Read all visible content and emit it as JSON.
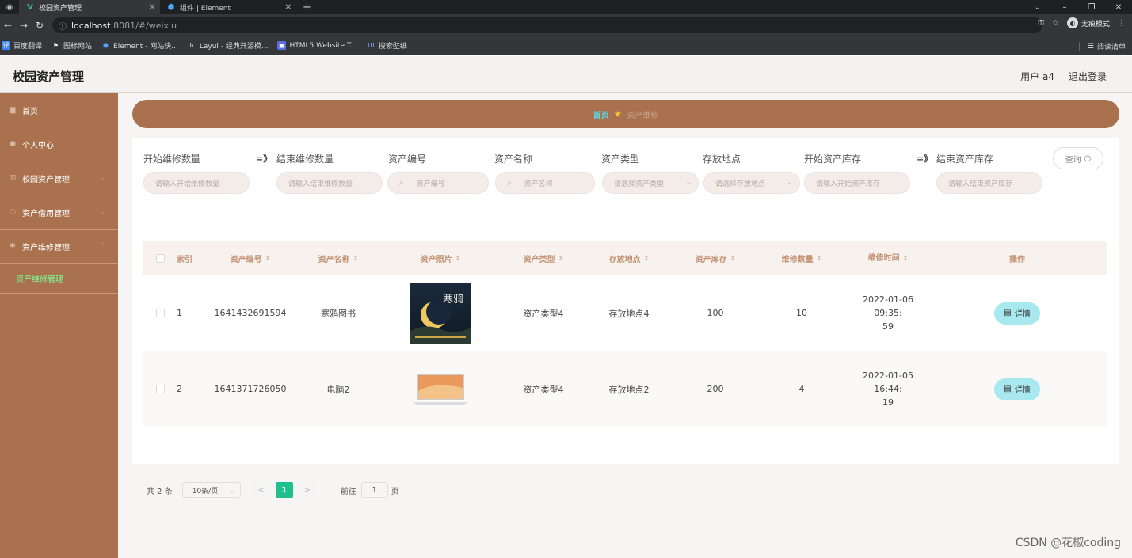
{
  "browser": {
    "tabs": [
      {
        "title": "校园资产管理",
        "icon": "vue-favicon-icon"
      },
      {
        "title": "组件 | Element",
        "icon": "element-favicon-icon"
      }
    ],
    "url_host": "localhost",
    "url_path": ":8081/#/weixiu",
    "incognito_label": "无痕模式",
    "bookmarks": [
      "百度翻译",
      "图标网站",
      "Element - 网站快...",
      "Layui - 经典开源模...",
      "HTML5 Website T...",
      "搜索壁纸"
    ],
    "reading_list": "阅读清单"
  },
  "header": {
    "title": "校园资产管理",
    "user": "用户 a4",
    "logout": "退出登录"
  },
  "sidebar": {
    "items": [
      {
        "label": "首页"
      },
      {
        "label": "个人中心"
      },
      {
        "label": "校园资产管理"
      },
      {
        "label": "资产借用管理"
      },
      {
        "label": "资产维修管理"
      }
    ],
    "active_sub": "资产维修管理"
  },
  "breadcrumb": {
    "home": "首页",
    "current": "资产维修"
  },
  "search": {
    "labels": {
      "start_qty": "开始维修数量",
      "end_qty": "结束维修数量",
      "asset_no": "资产编号",
      "asset_name": "资产名称",
      "asset_type": "资产类型",
      "location": "存放地点",
      "start_stock": "开始资产库存",
      "end_stock": "结束资产库存"
    },
    "range_sep": "=》",
    "placeholders": {
      "start_qty": "请输入开始维修数量",
      "end_qty": "请输入结束维修数量",
      "asset_no": "资产编号",
      "asset_name": "资产名称",
      "asset_type": "请选择资产类型",
      "location": "请选择存放地点",
      "start_stock": "请输入开始资产库存",
      "end_stock": "请输入结束资产库存"
    },
    "query_button": "查询"
  },
  "table": {
    "headers": {
      "index": "索引",
      "asset_no": "资产编号",
      "asset_name": "资产名称",
      "photo": "资产照片",
      "type": "资产类型",
      "location": "存放地点",
      "stock": "资产库存",
      "repair_qty": "维修数量",
      "repair_time": "维修时间",
      "ops": "操作"
    },
    "rows": [
      {
        "index": "1",
        "asset_no": "1641432691594",
        "asset_name": "寒鸦图书",
        "type": "资产类型4",
        "location": "存放地点4",
        "stock": "100",
        "repair_qty": "10",
        "time_line1": "2022-01-06 09:35:",
        "time_line2": "59",
        "action": "详情",
        "photo_text": "寒鸦"
      },
      {
        "index": "2",
        "asset_no": "1641371726050",
        "asset_name": "电脑2",
        "type": "资产类型4",
        "location": "存放地点2",
        "stock": "200",
        "repair_qty": "4",
        "time_line1": "2022-01-05 16:44:",
        "time_line2": "19",
        "action": "详情",
        "photo_text": ""
      }
    ]
  },
  "pagination": {
    "total": "共 2 条",
    "page_size": "10条/页",
    "prev": "<",
    "next": ">",
    "current_page": "1",
    "goto_label": "前往",
    "goto_value": "1",
    "page_unit": "页"
  },
  "watermark": "CSDN @花椒coding",
  "colors": {
    "sidebar": "#a9714d",
    "breadcrumb_bar": "#a9714d",
    "active_submenu": "#7dff9a",
    "detail_button": "#a8e8ef",
    "current_page": "#1fbf8f"
  }
}
